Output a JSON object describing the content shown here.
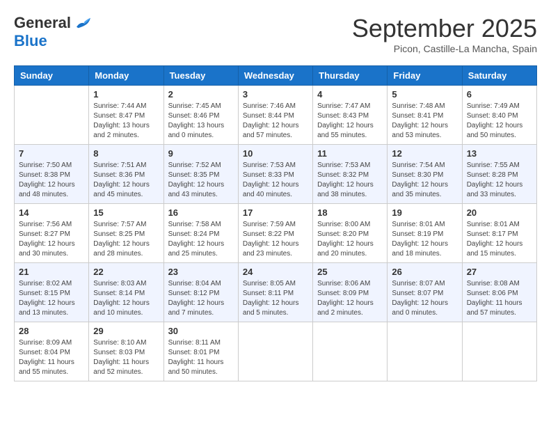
{
  "header": {
    "logo_general": "General",
    "logo_blue": "Blue",
    "month_title": "September 2025",
    "subtitle": "Picon, Castille-La Mancha, Spain"
  },
  "days_of_week": [
    "Sunday",
    "Monday",
    "Tuesday",
    "Wednesday",
    "Thursday",
    "Friday",
    "Saturday"
  ],
  "weeks": [
    [
      {
        "day": "",
        "sunrise": "",
        "sunset": "",
        "daylight": ""
      },
      {
        "day": "1",
        "sunrise": "Sunrise: 7:44 AM",
        "sunset": "Sunset: 8:47 PM",
        "daylight": "Daylight: 13 hours and 2 minutes."
      },
      {
        "day": "2",
        "sunrise": "Sunrise: 7:45 AM",
        "sunset": "Sunset: 8:46 PM",
        "daylight": "Daylight: 13 hours and 0 minutes."
      },
      {
        "day": "3",
        "sunrise": "Sunrise: 7:46 AM",
        "sunset": "Sunset: 8:44 PM",
        "daylight": "Daylight: 12 hours and 57 minutes."
      },
      {
        "day": "4",
        "sunrise": "Sunrise: 7:47 AM",
        "sunset": "Sunset: 8:43 PM",
        "daylight": "Daylight: 12 hours and 55 minutes."
      },
      {
        "day": "5",
        "sunrise": "Sunrise: 7:48 AM",
        "sunset": "Sunset: 8:41 PM",
        "daylight": "Daylight: 12 hours and 53 minutes."
      },
      {
        "day": "6",
        "sunrise": "Sunrise: 7:49 AM",
        "sunset": "Sunset: 8:40 PM",
        "daylight": "Daylight: 12 hours and 50 minutes."
      }
    ],
    [
      {
        "day": "7",
        "sunrise": "Sunrise: 7:50 AM",
        "sunset": "Sunset: 8:38 PM",
        "daylight": "Daylight: 12 hours and 48 minutes."
      },
      {
        "day": "8",
        "sunrise": "Sunrise: 7:51 AM",
        "sunset": "Sunset: 8:36 PM",
        "daylight": "Daylight: 12 hours and 45 minutes."
      },
      {
        "day": "9",
        "sunrise": "Sunrise: 7:52 AM",
        "sunset": "Sunset: 8:35 PM",
        "daylight": "Daylight: 12 hours and 43 minutes."
      },
      {
        "day": "10",
        "sunrise": "Sunrise: 7:53 AM",
        "sunset": "Sunset: 8:33 PM",
        "daylight": "Daylight: 12 hours and 40 minutes."
      },
      {
        "day": "11",
        "sunrise": "Sunrise: 7:53 AM",
        "sunset": "Sunset: 8:32 PM",
        "daylight": "Daylight: 12 hours and 38 minutes."
      },
      {
        "day": "12",
        "sunrise": "Sunrise: 7:54 AM",
        "sunset": "Sunset: 8:30 PM",
        "daylight": "Daylight: 12 hours and 35 minutes."
      },
      {
        "day": "13",
        "sunrise": "Sunrise: 7:55 AM",
        "sunset": "Sunset: 8:28 PM",
        "daylight": "Daylight: 12 hours and 33 minutes."
      }
    ],
    [
      {
        "day": "14",
        "sunrise": "Sunrise: 7:56 AM",
        "sunset": "Sunset: 8:27 PM",
        "daylight": "Daylight: 12 hours and 30 minutes."
      },
      {
        "day": "15",
        "sunrise": "Sunrise: 7:57 AM",
        "sunset": "Sunset: 8:25 PM",
        "daylight": "Daylight: 12 hours and 28 minutes."
      },
      {
        "day": "16",
        "sunrise": "Sunrise: 7:58 AM",
        "sunset": "Sunset: 8:24 PM",
        "daylight": "Daylight: 12 hours and 25 minutes."
      },
      {
        "day": "17",
        "sunrise": "Sunrise: 7:59 AM",
        "sunset": "Sunset: 8:22 PM",
        "daylight": "Daylight: 12 hours and 23 minutes."
      },
      {
        "day": "18",
        "sunrise": "Sunrise: 8:00 AM",
        "sunset": "Sunset: 8:20 PM",
        "daylight": "Daylight: 12 hours and 20 minutes."
      },
      {
        "day": "19",
        "sunrise": "Sunrise: 8:01 AM",
        "sunset": "Sunset: 8:19 PM",
        "daylight": "Daylight: 12 hours and 18 minutes."
      },
      {
        "day": "20",
        "sunrise": "Sunrise: 8:01 AM",
        "sunset": "Sunset: 8:17 PM",
        "daylight": "Daylight: 12 hours and 15 minutes."
      }
    ],
    [
      {
        "day": "21",
        "sunrise": "Sunrise: 8:02 AM",
        "sunset": "Sunset: 8:15 PM",
        "daylight": "Daylight: 12 hours and 13 minutes."
      },
      {
        "day": "22",
        "sunrise": "Sunrise: 8:03 AM",
        "sunset": "Sunset: 8:14 PM",
        "daylight": "Daylight: 12 hours and 10 minutes."
      },
      {
        "day": "23",
        "sunrise": "Sunrise: 8:04 AM",
        "sunset": "Sunset: 8:12 PM",
        "daylight": "Daylight: 12 hours and 7 minutes."
      },
      {
        "day": "24",
        "sunrise": "Sunrise: 8:05 AM",
        "sunset": "Sunset: 8:11 PM",
        "daylight": "Daylight: 12 hours and 5 minutes."
      },
      {
        "day": "25",
        "sunrise": "Sunrise: 8:06 AM",
        "sunset": "Sunset: 8:09 PM",
        "daylight": "Daylight: 12 hours and 2 minutes."
      },
      {
        "day": "26",
        "sunrise": "Sunrise: 8:07 AM",
        "sunset": "Sunset: 8:07 PM",
        "daylight": "Daylight: 12 hours and 0 minutes."
      },
      {
        "day": "27",
        "sunrise": "Sunrise: 8:08 AM",
        "sunset": "Sunset: 8:06 PM",
        "daylight": "Daylight: 11 hours and 57 minutes."
      }
    ],
    [
      {
        "day": "28",
        "sunrise": "Sunrise: 8:09 AM",
        "sunset": "Sunset: 8:04 PM",
        "daylight": "Daylight: 11 hours and 55 minutes."
      },
      {
        "day": "29",
        "sunrise": "Sunrise: 8:10 AM",
        "sunset": "Sunset: 8:03 PM",
        "daylight": "Daylight: 11 hours and 52 minutes."
      },
      {
        "day": "30",
        "sunrise": "Sunrise: 8:11 AM",
        "sunset": "Sunset: 8:01 PM",
        "daylight": "Daylight: 11 hours and 50 minutes."
      },
      {
        "day": "",
        "sunrise": "",
        "sunset": "",
        "daylight": ""
      },
      {
        "day": "",
        "sunrise": "",
        "sunset": "",
        "daylight": ""
      },
      {
        "day": "",
        "sunrise": "",
        "sunset": "",
        "daylight": ""
      },
      {
        "day": "",
        "sunrise": "",
        "sunset": "",
        "daylight": ""
      }
    ]
  ]
}
